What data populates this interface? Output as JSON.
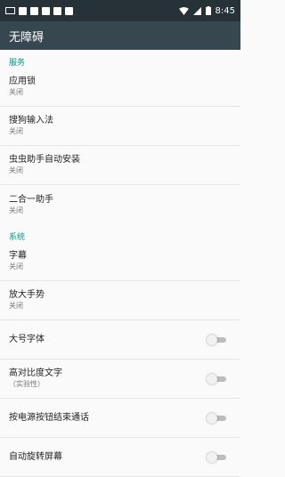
{
  "status_bar": {
    "time": "8:45",
    "icons": [
      "screen-share-icon",
      "notification-square-icon",
      "notification-square-icon",
      "notification-square-icon",
      "notification-square-icon",
      "notification-square-icon",
      "wifi-icon",
      "signal-icon",
      "battery-icon"
    ]
  },
  "app_bar": {
    "title": "无障碍"
  },
  "sections": {
    "services": {
      "title": "服务"
    },
    "system": {
      "title": "系统"
    }
  },
  "services_items": [
    {
      "title": "应用锁",
      "subtitle": "关闭"
    },
    {
      "title": "搜狗输入法",
      "subtitle": "关闭"
    },
    {
      "title": "虫虫助手自动安装",
      "subtitle": "关闭"
    },
    {
      "title": "二合一助手",
      "subtitle": "关闭"
    }
  ],
  "system_items": [
    {
      "title": "字幕",
      "subtitle": "关闭"
    },
    {
      "title": "放大手势",
      "subtitle": "关闭"
    },
    {
      "title": "大号字体",
      "switch_on": false
    },
    {
      "title": "高对比度文字",
      "subtitle": "（实验性）",
      "switch_on": false
    },
    {
      "title": "按电源按钮结束通话",
      "switch_on": false
    },
    {
      "title": "自动旋转屏幕",
      "switch_on": false
    }
  ]
}
